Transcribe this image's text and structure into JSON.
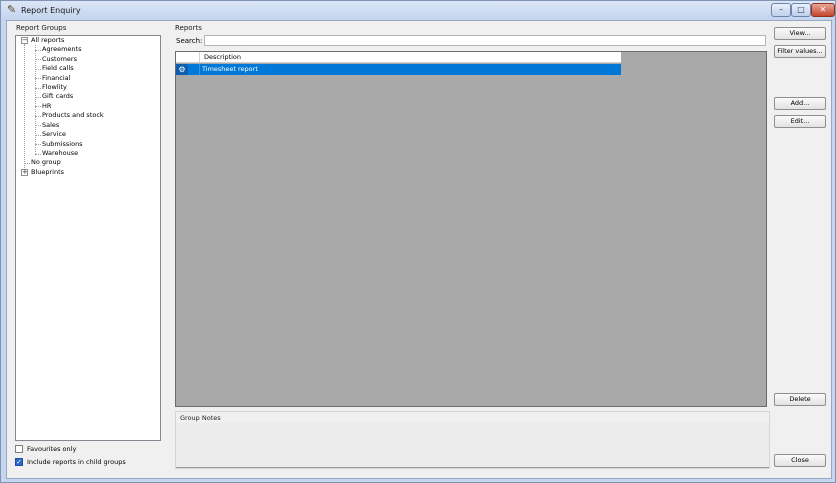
{
  "window": {
    "title": "Report Enquiry",
    "icon": "report-tool-icon",
    "controls": {
      "minimize": "–",
      "maximize": "□",
      "close": "✕"
    }
  },
  "report_groups": {
    "label": "Report Groups",
    "tree": {
      "root": {
        "label": "All reports",
        "expander": "−"
      },
      "children": [
        "Agreements",
        "Customers",
        "Field calls",
        "Financial",
        "Flowlity",
        "Gift cards",
        "HR",
        "Products and stock",
        "Sales",
        "Service",
        "Submissions",
        "Warehouse"
      ],
      "no_group": "No group",
      "blueprints": {
        "label": "Blueprints",
        "expander": "+"
      }
    },
    "favourites_only": {
      "label": "Favourites only",
      "checked": false
    },
    "include_child_groups": {
      "label": "Include reports in child groups",
      "checked": true
    }
  },
  "reports": {
    "label": "Reports",
    "search_label": "Search:",
    "search_value": "",
    "columns": [
      "Description"
    ],
    "rows": [
      {
        "icon": "gear-icon",
        "description": "Timesheet report",
        "selected": true
      }
    ]
  },
  "group_notes": {
    "label": "Group Notes",
    "value": ""
  },
  "buttons": {
    "view": "View...",
    "filter_values": "Filter values...",
    "add": "Add...",
    "edit": "Edit...",
    "delete": "Delete",
    "close": "Close"
  },
  "colors": {
    "selection": "#0078d7",
    "grid_background": "#a9a9a9",
    "window_frame": "#c5d6ee"
  }
}
